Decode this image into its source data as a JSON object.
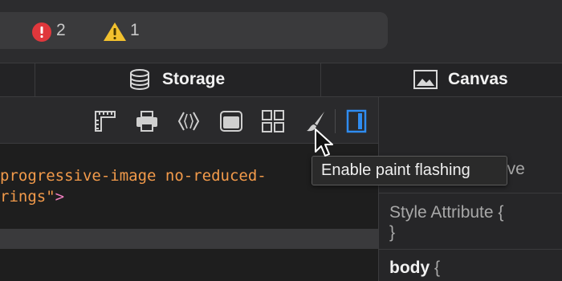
{
  "status": {
    "error_count": "2",
    "warning_count": "1"
  },
  "tabs": [
    {
      "label": "Storage",
      "icon": "database-icon"
    },
    {
      "label": "Canvas",
      "icon": "image-icon"
    }
  ],
  "toolbar": {
    "icons": [
      "ruler-icon",
      "print-icon",
      "angle-brackets-icon",
      "window-icon",
      "grid-icon",
      "paintbrush-icon",
      "sidebar-toggle-icon"
    ],
    "accent_color": "#2f8cf0"
  },
  "code": {
    "line1": "progressive-image no-reduced-",
    "line2_attr": "rings\"",
    "line2_tag": ">"
  },
  "sidebar": {
    "partial_label": "ive",
    "style_attribute": "Style Attribute",
    "open_brace": "{",
    "close_brace": "}",
    "selector": "body",
    "selector_brace": "{"
  },
  "tooltip": {
    "text": "Enable paint flashing"
  },
  "colors": {
    "error": "#e0373c",
    "warning": "#f2c12e",
    "string_orange": "#f29a4a",
    "tag_pink": "#f07fc0"
  }
}
